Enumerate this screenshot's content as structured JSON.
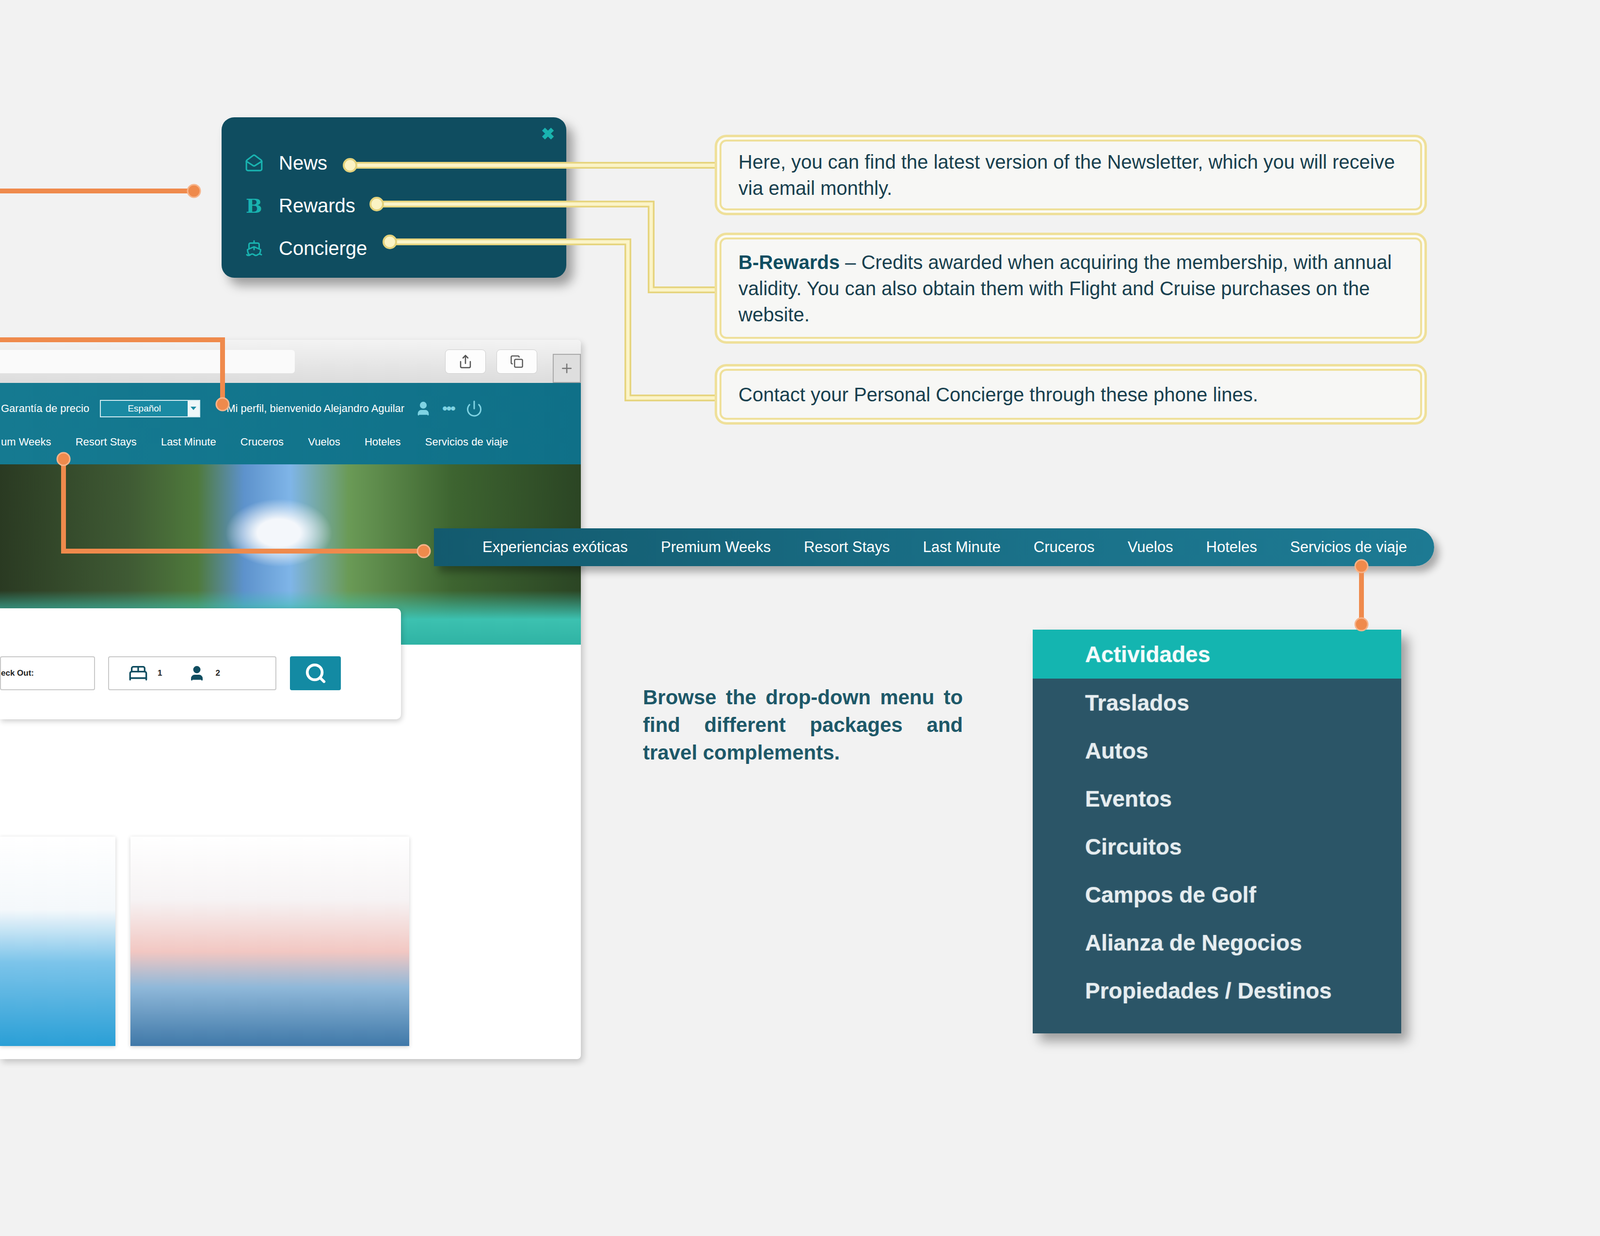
{
  "popup": {
    "close": "✖",
    "items": [
      {
        "label": "News",
        "kind": "mail"
      },
      {
        "label": "Rewards",
        "kind": "letter",
        "glyph": "B"
      },
      {
        "label": "Concierge",
        "kind": "ship"
      }
    ]
  },
  "callouts": [
    {
      "text": "Here, you can find the latest version of the Newsletter, which you will receive via email monthly."
    },
    {
      "bold": "B-Rewards",
      "text": " – Credits awarded when acquiring the membership, with annual validity. You can also obtain them with Flight and Cruise purchases on the website."
    },
    {
      "text": "Contact your Personal Concierge through these phone lines."
    }
  ],
  "browser": {
    "header": {
      "price_guarantee": "Garantía de precio",
      "language": "Español",
      "greeting": "Mi perfil, bienvenido Alejandro Aguilar",
      "more": "•••"
    },
    "nav": [
      "um Weeks",
      "Resort Stays",
      "Last Minute",
      "Cruceros",
      "Vuelos",
      "Hoteles",
      "Servicios de viaje"
    ],
    "search": {
      "check_out_label": "eck Out:",
      "rooms": "1",
      "guests": "2"
    }
  },
  "nav_strip": [
    "Experiencias exóticas",
    "Premium Weeks",
    "Resort Stays",
    "Last Minute",
    "Cruceros",
    "Vuelos",
    "Hoteles",
    "Servicios de viaje"
  ],
  "description": "Browse the drop-down menu to find different packages and travel complements.",
  "dropdown": [
    {
      "label": "Actividades",
      "selected": true
    },
    {
      "label": "Traslados",
      "selected": false
    },
    {
      "label": "Autos",
      "selected": false
    },
    {
      "label": "Eventos",
      "selected": false
    },
    {
      "label": "Circuitos",
      "selected": false
    },
    {
      "label": "Campos de Golf",
      "selected": false
    },
    {
      "label": "Alianza de Negocios",
      "selected": false
    },
    {
      "label": "Propiedades / Destinos",
      "selected": false
    }
  ]
}
